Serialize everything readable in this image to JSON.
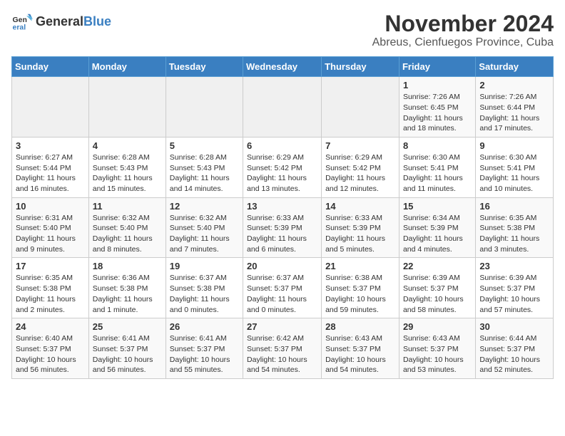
{
  "logo": {
    "text_general": "General",
    "text_blue": "Blue"
  },
  "title": "November 2024",
  "subtitle": "Abreus, Cienfuegos Province, Cuba",
  "days_of_week": [
    "Sunday",
    "Monday",
    "Tuesday",
    "Wednesday",
    "Thursday",
    "Friday",
    "Saturday"
  ],
  "weeks": [
    [
      {
        "day": "",
        "info": ""
      },
      {
        "day": "",
        "info": ""
      },
      {
        "day": "",
        "info": ""
      },
      {
        "day": "",
        "info": ""
      },
      {
        "day": "",
        "info": ""
      },
      {
        "day": "1",
        "info": "Sunrise: 7:26 AM\nSunset: 6:45 PM\nDaylight: 11 hours and 18 minutes."
      },
      {
        "day": "2",
        "info": "Sunrise: 7:26 AM\nSunset: 6:44 PM\nDaylight: 11 hours and 17 minutes."
      }
    ],
    [
      {
        "day": "3",
        "info": "Sunrise: 6:27 AM\nSunset: 5:44 PM\nDaylight: 11 hours and 16 minutes."
      },
      {
        "day": "4",
        "info": "Sunrise: 6:28 AM\nSunset: 5:43 PM\nDaylight: 11 hours and 15 minutes."
      },
      {
        "day": "5",
        "info": "Sunrise: 6:28 AM\nSunset: 5:43 PM\nDaylight: 11 hours and 14 minutes."
      },
      {
        "day": "6",
        "info": "Sunrise: 6:29 AM\nSunset: 5:42 PM\nDaylight: 11 hours and 13 minutes."
      },
      {
        "day": "7",
        "info": "Sunrise: 6:29 AM\nSunset: 5:42 PM\nDaylight: 11 hours and 12 minutes."
      },
      {
        "day": "8",
        "info": "Sunrise: 6:30 AM\nSunset: 5:41 PM\nDaylight: 11 hours and 11 minutes."
      },
      {
        "day": "9",
        "info": "Sunrise: 6:30 AM\nSunset: 5:41 PM\nDaylight: 11 hours and 10 minutes."
      }
    ],
    [
      {
        "day": "10",
        "info": "Sunrise: 6:31 AM\nSunset: 5:40 PM\nDaylight: 11 hours and 9 minutes."
      },
      {
        "day": "11",
        "info": "Sunrise: 6:32 AM\nSunset: 5:40 PM\nDaylight: 11 hours and 8 minutes."
      },
      {
        "day": "12",
        "info": "Sunrise: 6:32 AM\nSunset: 5:40 PM\nDaylight: 11 hours and 7 minutes."
      },
      {
        "day": "13",
        "info": "Sunrise: 6:33 AM\nSunset: 5:39 PM\nDaylight: 11 hours and 6 minutes."
      },
      {
        "day": "14",
        "info": "Sunrise: 6:33 AM\nSunset: 5:39 PM\nDaylight: 11 hours and 5 minutes."
      },
      {
        "day": "15",
        "info": "Sunrise: 6:34 AM\nSunset: 5:39 PM\nDaylight: 11 hours and 4 minutes."
      },
      {
        "day": "16",
        "info": "Sunrise: 6:35 AM\nSunset: 5:38 PM\nDaylight: 11 hours and 3 minutes."
      }
    ],
    [
      {
        "day": "17",
        "info": "Sunrise: 6:35 AM\nSunset: 5:38 PM\nDaylight: 11 hours and 2 minutes."
      },
      {
        "day": "18",
        "info": "Sunrise: 6:36 AM\nSunset: 5:38 PM\nDaylight: 11 hours and 1 minute."
      },
      {
        "day": "19",
        "info": "Sunrise: 6:37 AM\nSunset: 5:38 PM\nDaylight: 11 hours and 0 minutes."
      },
      {
        "day": "20",
        "info": "Sunrise: 6:37 AM\nSunset: 5:37 PM\nDaylight: 11 hours and 0 minutes."
      },
      {
        "day": "21",
        "info": "Sunrise: 6:38 AM\nSunset: 5:37 PM\nDaylight: 10 hours and 59 minutes."
      },
      {
        "day": "22",
        "info": "Sunrise: 6:39 AM\nSunset: 5:37 PM\nDaylight: 10 hours and 58 minutes."
      },
      {
        "day": "23",
        "info": "Sunrise: 6:39 AM\nSunset: 5:37 PM\nDaylight: 10 hours and 57 minutes."
      }
    ],
    [
      {
        "day": "24",
        "info": "Sunrise: 6:40 AM\nSunset: 5:37 PM\nDaylight: 10 hours and 56 minutes."
      },
      {
        "day": "25",
        "info": "Sunrise: 6:41 AM\nSunset: 5:37 PM\nDaylight: 10 hours and 56 minutes."
      },
      {
        "day": "26",
        "info": "Sunrise: 6:41 AM\nSunset: 5:37 PM\nDaylight: 10 hours and 55 minutes."
      },
      {
        "day": "27",
        "info": "Sunrise: 6:42 AM\nSunset: 5:37 PM\nDaylight: 10 hours and 54 minutes."
      },
      {
        "day": "28",
        "info": "Sunrise: 6:43 AM\nSunset: 5:37 PM\nDaylight: 10 hours and 54 minutes."
      },
      {
        "day": "29",
        "info": "Sunrise: 6:43 AM\nSunset: 5:37 PM\nDaylight: 10 hours and 53 minutes."
      },
      {
        "day": "30",
        "info": "Sunrise: 6:44 AM\nSunset: 5:37 PM\nDaylight: 10 hours and 52 minutes."
      }
    ]
  ]
}
